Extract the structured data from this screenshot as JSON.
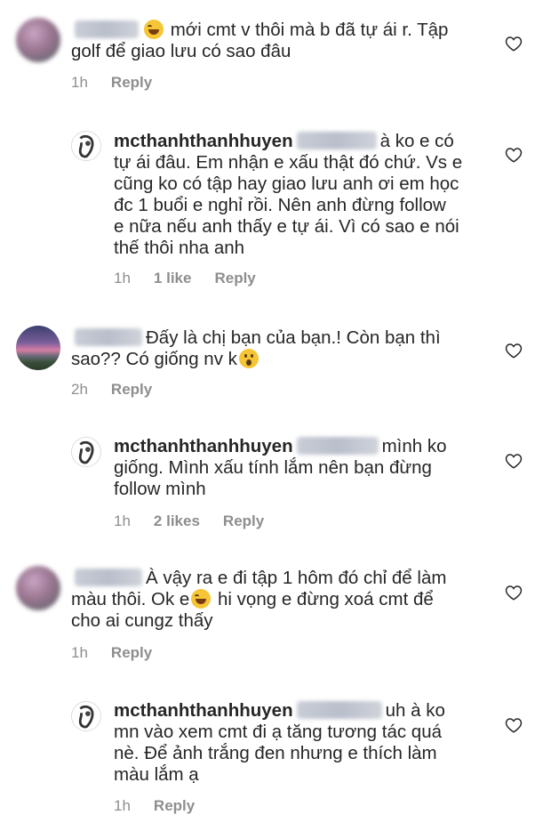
{
  "icons": {
    "heart": "heart-icon",
    "laugh": "tears-of-joy-emoji",
    "wow": "astonished-emoji"
  },
  "colors": {
    "text": "#262626",
    "meta": "#8e8e8e"
  },
  "comments": [
    {
      "line1": "mới cmt v thôi mà b đã tự ái r. Tập",
      "line2": "golf để giao lưu có sao đâu",
      "time": "1h",
      "reply": "Reply"
    },
    {
      "username": "mcthanhthanhhuyen",
      "line1": "à ko e có",
      "line2": "tự ái đâu. Em nhận e xấu thật đó chứ. Vs e",
      "line3": "cũng ko có tập hay giao lưu anh ơi em học",
      "line4": "đc 1 buổi e nghỉ rồi. Nên anh đừng follow",
      "line5": "e nữa nếu anh thấy e tự ái. Vì có sao e nói",
      "line6": "thế thôi nha anh",
      "time": "1h",
      "likes": "1 like",
      "reply": "Reply"
    },
    {
      "line1": "Đấy là chị bạn của bạn.! Còn bạn thì",
      "line2": "sao?? Có giống nv k",
      "time": "2h",
      "reply": "Reply"
    },
    {
      "username": "mcthanhthanhhuyen",
      "line1": "mình ko",
      "line2": "giống. Mình xấu tính lắm nên bạn đừng",
      "line3": "follow mình",
      "time": "1h",
      "likes": "2 likes",
      "reply": "Reply"
    },
    {
      "line1": "À vậy ra e đi tập 1 hôm đó chỉ để làm",
      "line2a": "màu thôi. Ok e",
      "line2b": "hi vọng e đừng xoá cmt để",
      "line3": "cho ai cungz thấy",
      "time": "1h",
      "reply": "Reply"
    },
    {
      "username": "mcthanhthanhhuyen",
      "line1": "uh à ko",
      "line2": "mn vào xem cmt đi ạ tăng tương tác quá",
      "line3": "nè. Để ảnh trắng đen nhưng e thích làm",
      "line4": "màu lắm ạ",
      "time": "1h",
      "reply": "Reply"
    }
  ]
}
